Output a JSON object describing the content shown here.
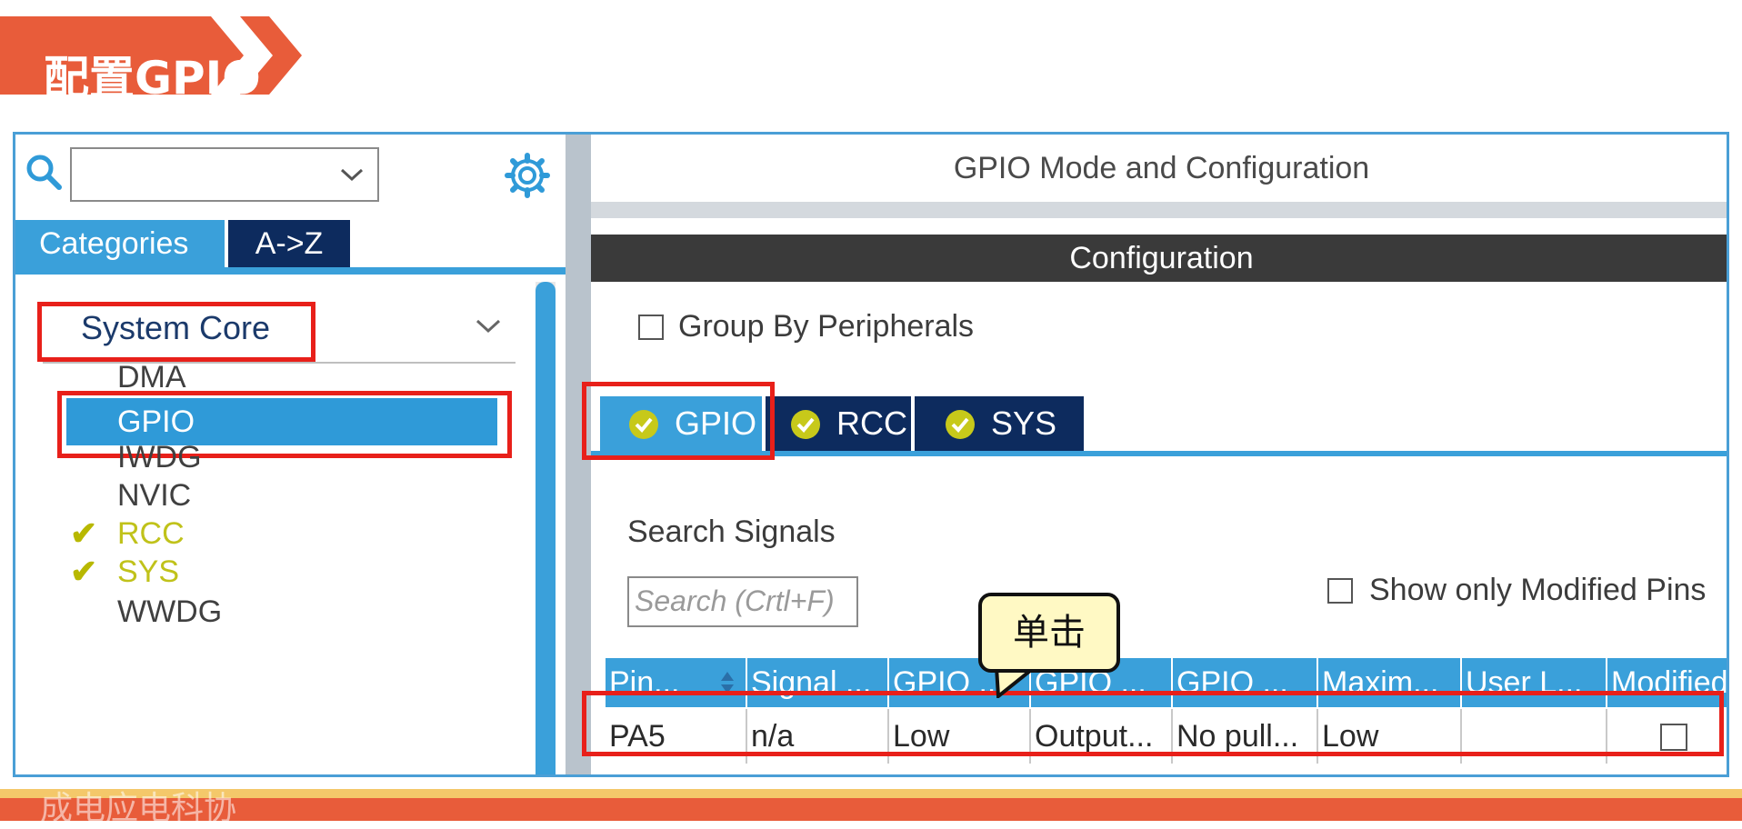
{
  "banner": {
    "title": "配置GPIO"
  },
  "left": {
    "search": {
      "value": ""
    },
    "tabs": [
      {
        "label": "Categories"
      },
      {
        "label": "A->Z"
      }
    ],
    "category": {
      "label": "System Core"
    },
    "items": [
      {
        "label": "DMA",
        "state": "normal"
      },
      {
        "label": "GPIO",
        "state": "selected"
      },
      {
        "label": "IWDG",
        "state": "normal"
      },
      {
        "label": "NVIC",
        "state": "normal"
      },
      {
        "label": "RCC",
        "state": "configured"
      },
      {
        "label": "SYS",
        "state": "configured"
      },
      {
        "label": "WWDG",
        "state": "normal"
      }
    ]
  },
  "right": {
    "title": "GPIO Mode and Configuration",
    "config_bar": "Configuration",
    "group_by_label": "Group By Peripherals",
    "tabs": [
      {
        "label": "GPIO"
      },
      {
        "label": "RCC"
      },
      {
        "label": "SYS"
      }
    ],
    "search_label": "Search Signals",
    "search_placeholder": "Search (Crtl+F)",
    "show_modified_label": "Show only Modified Pins",
    "table": {
      "headers": [
        "Pin...",
        "Signal ...",
        "GPIO ...",
        "GPIO ...",
        "GPIO ...",
        "Maxim...",
        "User L...",
        "Modified"
      ],
      "row": [
        "PA5",
        "n/a",
        "Low",
        "Output...",
        "No pull...",
        "Low",
        "",
        ""
      ]
    }
  },
  "callout": {
    "text": "单击"
  },
  "watermark": {
    "text": "成电应电科协"
  },
  "colors": {
    "accent": "#3aa0da",
    "dark_tab": "#0d2b5e",
    "highlight": "#e8201a",
    "banner": "#e85c3a"
  }
}
